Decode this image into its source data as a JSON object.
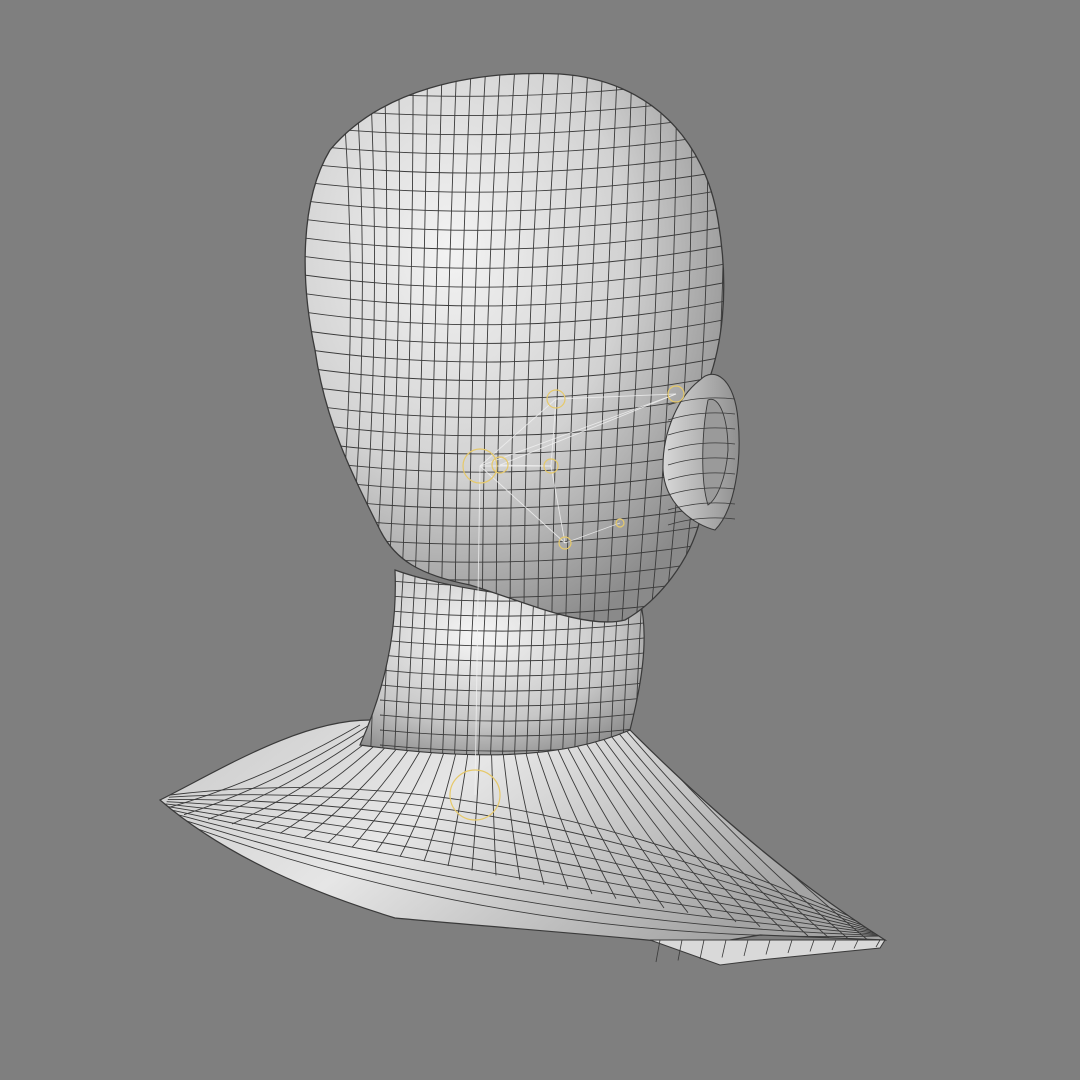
{
  "scene": {
    "subject": "wireframe-head-bust",
    "view": "rear-three-quarter",
    "colors": {
      "background": "#7f7f7f",
      "mesh_light": "#e9e9e9",
      "mesh_mid": "#bdbdbd",
      "mesh_dark": "#6f6f6f",
      "wire": "#3a3a3a",
      "rig_handle": "#e6c96a",
      "rig_line": "#f2f2f2"
    },
    "rig_handles": 8
  }
}
